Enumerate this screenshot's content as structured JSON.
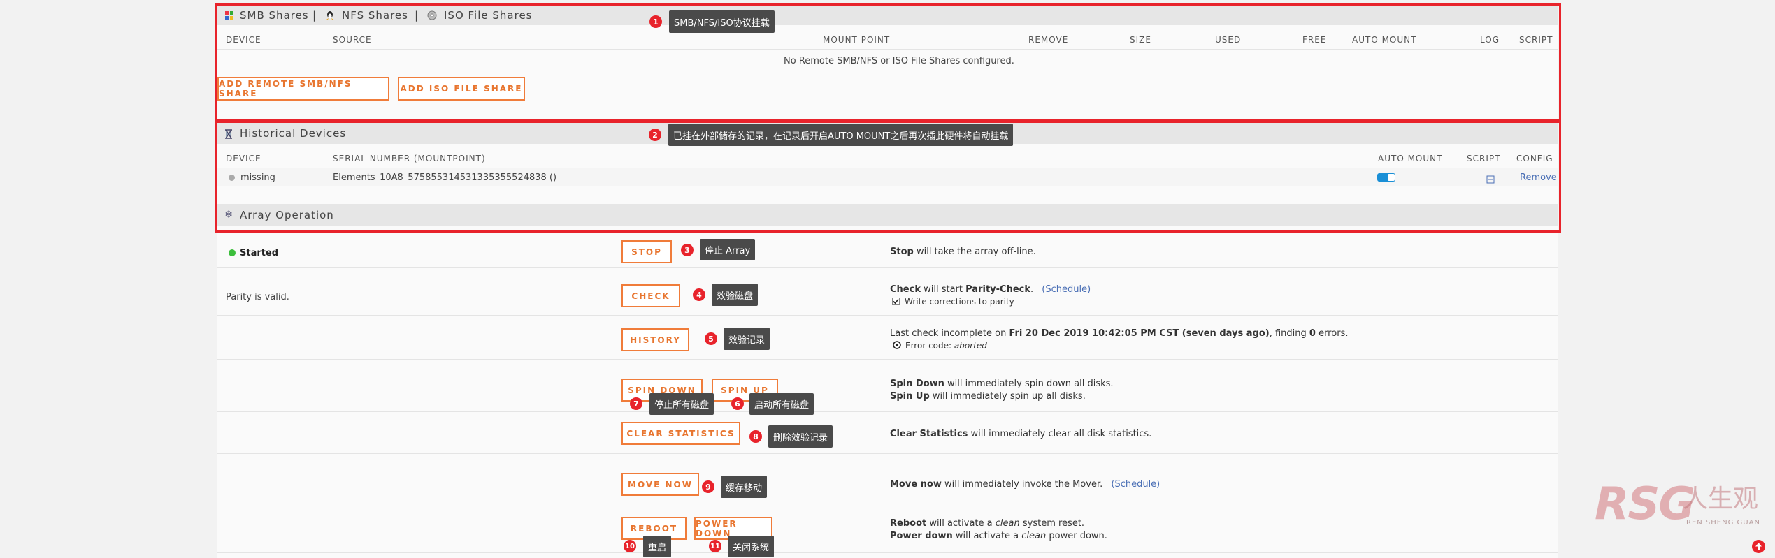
{
  "shares": {
    "tabs": [
      {
        "label": "SMB Shares"
      },
      {
        "label": "NFS Shares"
      },
      {
        "label": "ISO File Shares"
      }
    ],
    "tab_sep": "|",
    "columns": [
      "DEVICE",
      "SOURCE",
      "MOUNT POINT",
      "REMOVE",
      "SIZE",
      "USED",
      "FREE",
      "AUTO MOUNT",
      "LOG",
      "SCRIPT"
    ],
    "empty_message": "No Remote SMB/NFS or ISO File Shares configured.",
    "add_remote_label": "ADD REMOTE SMB/NFS SHARE",
    "add_iso_label": "ADD ISO FILE SHARE"
  },
  "historical": {
    "title": "Historical Devices",
    "columns": [
      "DEVICE",
      "SERIAL NUMBER (MOUNTPOINT)",
      "AUTO MOUNT",
      "SCRIPT",
      "CONFIG"
    ],
    "row": {
      "device": "missing",
      "serial": "Elements_10A8_575855314531335355524838 ()",
      "auto_mount": true,
      "config_action": "Remove"
    }
  },
  "array": {
    "title": "Array Operation",
    "status": "Started",
    "parity_status": "Parity is valid.",
    "buttons": {
      "stop": "STOP",
      "check": "CHECK",
      "history": "HISTORY",
      "spin_down": "SPIN DOWN",
      "spin_up": "SPIN UP",
      "clear_statistics": "CLEAR STATISTICS",
      "move_now": "MOVE NOW",
      "reboot": "REBOOT",
      "power_down": "POWER DOWN"
    },
    "descriptions": {
      "stop_bold": "Stop",
      "stop_rest": " will take the array off-line.",
      "check_bold": "Check",
      "check_mid": " will start ",
      "check_bold2": "Parity-Check",
      "check_end": ".",
      "check_link": "(Schedule)",
      "write_corrections": "Write corrections to parity",
      "write_corrections_checked": true,
      "history_pre": "Last check incomplete on ",
      "history_date": "Fri 20 Dec 2019 10:42:05 PM CST (seven days ago)",
      "history_mid": ", finding ",
      "history_errors": "0",
      "history_end": " errors.",
      "error_code_label": "Error code: ",
      "error_code_value": "aborted",
      "spin_down_bold": "Spin Down",
      "spin_down_rest": " will immediately spin down all disks.",
      "spin_up_bold": "Spin Up",
      "spin_up_rest": " will immediately spin up all disks.",
      "clear_bold": "Clear Statistics",
      "clear_rest": " will immediately clear all disk statistics.",
      "move_bold": "Move now",
      "move_rest": " will immediately invoke the Mover.",
      "move_link": "(Schedule)",
      "reboot_bold": "Reboot",
      "reboot_mid": " will activate a ",
      "reboot_em": "clean",
      "reboot_end": " system reset.",
      "power_bold": "Power down",
      "power_mid": " will activate a ",
      "power_em": "clean",
      "power_end": " power down."
    }
  },
  "annotations": [
    {
      "num": "1",
      "text": "SMB/NFS/ISO协议挂载"
    },
    {
      "num": "2",
      "text": "已挂在外部储存的记录，在记录后开启AUTO MOUNT之后再次插此硬件将自动挂载"
    },
    {
      "num": "3",
      "text": "停止 Array"
    },
    {
      "num": "4",
      "text": "效验磁盘"
    },
    {
      "num": "5",
      "text": "效验记录"
    },
    {
      "num": "6",
      "text": "启动所有磁盘"
    },
    {
      "num": "7",
      "text": "停止所有磁盘"
    },
    {
      "num": "8",
      "text": "删除效验记录"
    },
    {
      "num": "9",
      "text": "缓存移动"
    },
    {
      "num": "10",
      "text": "重启"
    },
    {
      "num": "11",
      "text": "关闭系统"
    }
  ],
  "watermark": {
    "brand": "RSG",
    "cn": "人生观",
    "pinyin": "REN SHENG GUAN"
  },
  "colors": {
    "accent": "#f07c3a",
    "annotation_red": "#e8232b",
    "link": "#4a6fb5",
    "started_green": "#3cbe3c",
    "toggle_blue": "#1a8fd6"
  }
}
